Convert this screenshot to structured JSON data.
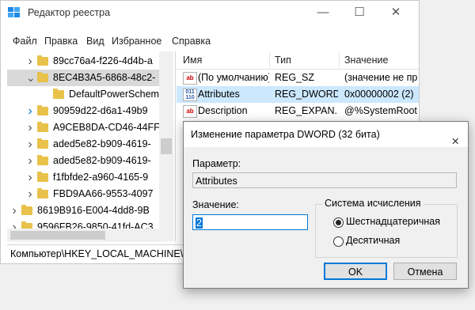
{
  "window": {
    "title": "Редактор реестра",
    "controls": {
      "minimize": "—",
      "maximize": "☐",
      "close": "✕"
    }
  },
  "menu": [
    "Файл",
    "Правка",
    "Вид",
    "Избранное",
    "Справка"
  ],
  "tree": {
    "items": [
      {
        "label": "89cc76a4-f226-4d4b-a",
        "level": 1,
        "expanded": false,
        "selected": false
      },
      {
        "label": "8EC4B3A5-6868-48c2-",
        "level": 1,
        "expanded": true,
        "selected": true
      },
      {
        "label": "DefaultPowerScheme",
        "level": 2,
        "expanded": null,
        "selected": false
      },
      {
        "label": "90959d22-d6a1-49b9",
        "level": 1,
        "expanded": false,
        "selected": false,
        "accent": true
      },
      {
        "label": "A9CEB8DA-CD46-44FF",
        "level": 1,
        "expanded": false,
        "selected": false
      },
      {
        "label": "aded5e82-b909-4619-",
        "level": 1,
        "expanded": false,
        "selected": false
      },
      {
        "label": "aded5e82-b909-4619-",
        "level": 1,
        "expanded": false,
        "selected": false
      },
      {
        "label": "f1fbfde2-a960-4165-9",
        "level": 1,
        "expanded": false,
        "selected": false
      },
      {
        "label": "FBD9AA66-9553-4097",
        "level": 1,
        "expanded": false,
        "selected": false
      },
      {
        "label": "8619B916-E004-4dd8-9B",
        "level": 0,
        "expanded": false,
        "selected": false
      },
      {
        "label": "9596FB26-9850-41fd-AC3",
        "level": 0,
        "expanded": false,
        "selected": false
      }
    ]
  },
  "list": {
    "headers": {
      "name": "Имя",
      "type": "Тип",
      "value": "Значение"
    },
    "rows": [
      {
        "icon": "ab",
        "name": "(По умолчанию)",
        "type": "REG_SZ",
        "value": "(значение не пр"
      },
      {
        "icon": "dw",
        "name": "Attributes",
        "type": "REG_DWORD",
        "value": "0x00000002 (2)",
        "selected": true
      },
      {
        "icon": "ab",
        "name": "Description",
        "type": "REG_EXPAN...",
        "value": "@%SystemRoot"
      }
    ]
  },
  "status": "Компьютер\\HKEY_LOCAL_MACHINE\\S",
  "dialog": {
    "title": "Изменение параметра DWORD (32 бита)",
    "param_label": "Параметр:",
    "param_value": "Attributes",
    "value_label": "Значение:",
    "value_value": "2",
    "base_label": "Система исчисления",
    "radio_hex": "Шестнадцатеричная",
    "radio_dec": "Десятичная",
    "ok": "OK",
    "cancel": "Отмена",
    "close": "✕"
  },
  "colors": {
    "accent": "#0078d7",
    "selection": "#cce8ff",
    "folder": "#e8c24a"
  }
}
